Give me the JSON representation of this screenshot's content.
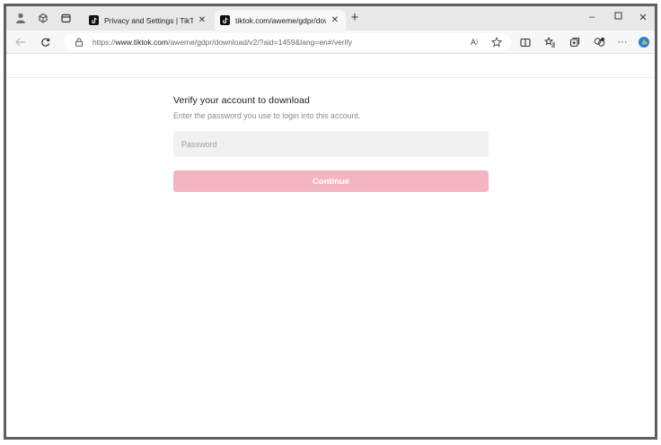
{
  "tabs": [
    {
      "title": "Privacy and Settings | TikTok",
      "active": false
    },
    {
      "title": "tiktok.com/aweme/gdpr/downlo",
      "active": true
    }
  ],
  "address": {
    "prefix": "https://",
    "host": "www.tiktok.com",
    "path": "/aweme/gdpr/download/v2/?aid=1459&lang=en#/verify"
  },
  "toolbar_icons": [
    "read-aloud-icon",
    "favorite-star-icon",
    "split-screen-icon",
    "favorites-icon",
    "collections-icon",
    "extensions-icon",
    "more-icon",
    "copilot-icon"
  ],
  "verify": {
    "heading": "Verify your account to download",
    "subtext": "Enter the password you use to login into this account.",
    "password_placeholder": "Password",
    "password_value": "",
    "continue_label": "Continue"
  },
  "colors": {
    "continue_button": "#f5b4c2",
    "tab_bar": "#e8e8e8",
    "input_bg": "#f1f1f2"
  }
}
